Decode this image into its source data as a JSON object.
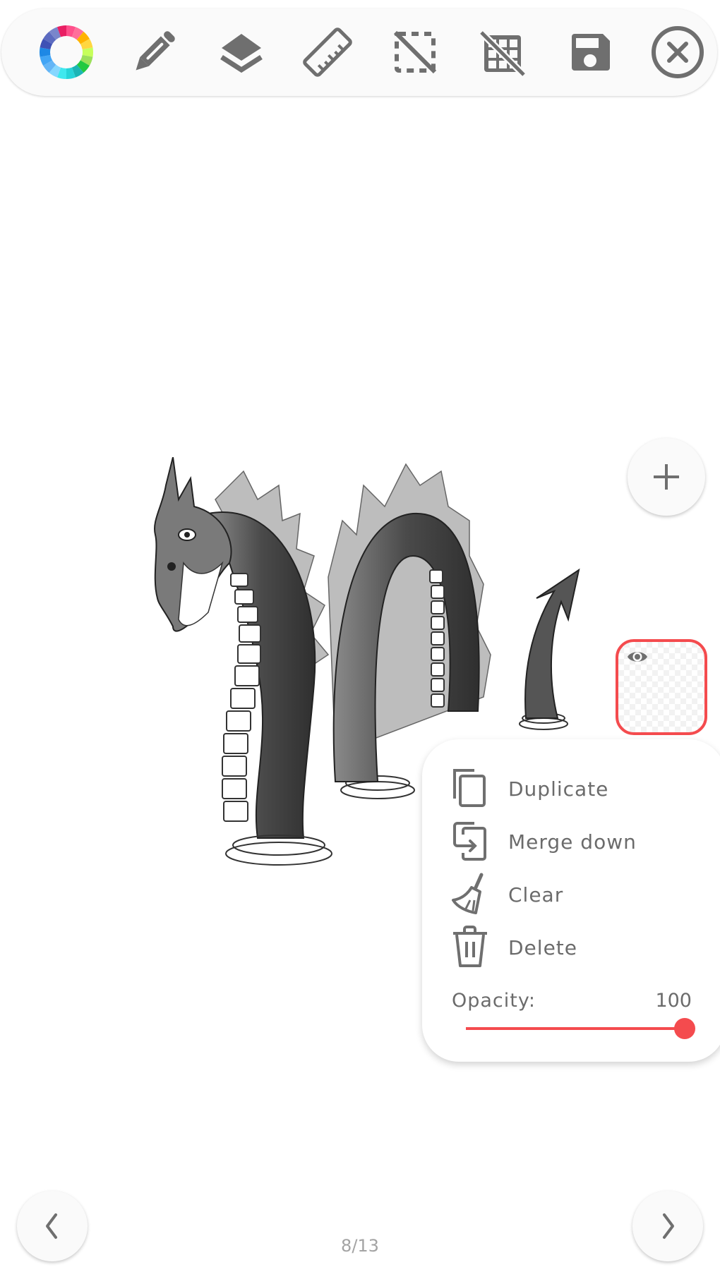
{
  "toolbar": {
    "tools": [
      {
        "name": "color-wheel-icon",
        "label": "Color picker"
      },
      {
        "name": "pencil-icon",
        "label": "Brush"
      },
      {
        "name": "layers-icon",
        "label": "Layers"
      },
      {
        "name": "ruler-icon",
        "label": "Ruler"
      },
      {
        "name": "selection-off-icon",
        "label": "Selection"
      },
      {
        "name": "grid-off-icon",
        "label": "Grid"
      },
      {
        "name": "save-icon",
        "label": "Save"
      },
      {
        "name": "close-circle-icon",
        "label": "Close"
      }
    ]
  },
  "canvas": {
    "subject": "sea serpent drawing"
  },
  "layers": {
    "add_icon": "plus-icon",
    "selected_layer": {
      "visible": true,
      "visibility_icon": "eye-icon",
      "accent_color": "#f44b4e"
    }
  },
  "layer_menu": {
    "items": [
      {
        "label": "Duplicate",
        "icon": "duplicate-icon"
      },
      {
        "label": "Merge down",
        "icon": "merge-down-icon"
      },
      {
        "label": "Clear",
        "icon": "broom-icon"
      },
      {
        "label": "Delete",
        "icon": "trash-icon"
      }
    ],
    "opacity": {
      "label": "Opacity:",
      "value": "100",
      "fraction": 1.0
    }
  },
  "navigation": {
    "prev_icon": "chevron-left-icon",
    "next_icon": "chevron-right-icon",
    "page_indicator": "8/13"
  },
  "colors": {
    "accent": "#f44b4e",
    "icon": "#6f6f6f",
    "toolbar_bg": "#fafafa"
  }
}
